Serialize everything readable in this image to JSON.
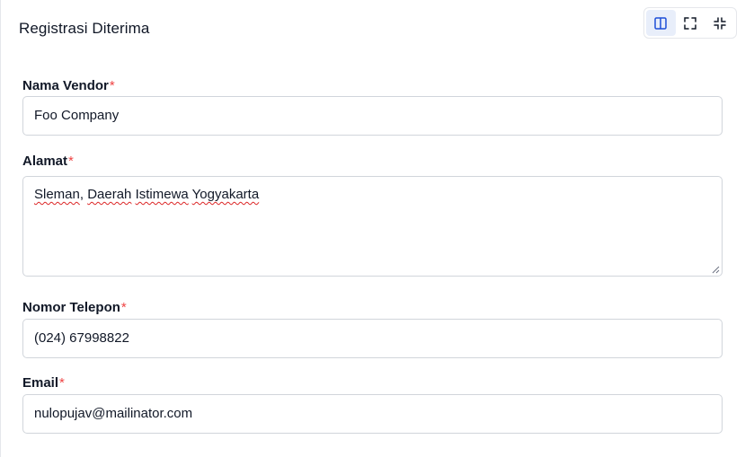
{
  "panel": {
    "title": "Registrasi Diterima"
  },
  "toolbar": {
    "buttons": [
      {
        "name": "split-view",
        "icon": "split-panel-icon",
        "active": true
      },
      {
        "name": "fullscreen",
        "icon": "expand-icon",
        "active": false
      },
      {
        "name": "exit-fullscreen",
        "icon": "collapse-icon",
        "active": false
      }
    ],
    "accent": "#1d4ed8"
  },
  "form": {
    "vendor_name": {
      "label": "Nama Vendor",
      "required_mark": "*",
      "value": "Foo Company"
    },
    "address": {
      "label": "Alamat",
      "required_mark": "*",
      "words": [
        "Sleman",
        ",",
        "Daerah",
        "Istimewa",
        "Yogyakarta"
      ]
    },
    "phone": {
      "label": "Nomor Telepon",
      "required_mark": "*",
      "value": "(024) 67998822"
    },
    "email": {
      "label": "Email",
      "required_mark": "*",
      "value": "nulopujav@mailinator.com"
    }
  },
  "colors": {
    "required": "#ef4444",
    "border": "#d1d5db",
    "active_bg": "#e8eefa",
    "text": "#111827"
  }
}
